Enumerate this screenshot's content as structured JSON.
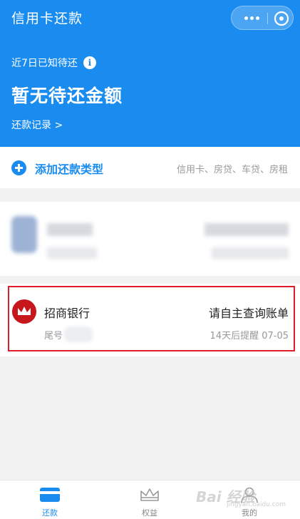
{
  "header": {
    "title": "信用卡还款",
    "pending_label": "近7日已知待还",
    "info_icon": "i",
    "status": "暂无待还金额",
    "history_link": "还款记录 >",
    "bg_color": "#1a8cf0"
  },
  "add_row": {
    "label": "添加还款类型",
    "types": "信用卡、房贷、车贷、房租"
  },
  "bank_card": {
    "name": "招商银行",
    "action": "请自主查询账单",
    "tail_label": "尾号",
    "reminder": "14天后提醒 07-05"
  },
  "tabs": [
    {
      "label": "还款",
      "icon": "card-icon",
      "active": true
    },
    {
      "label": "权益",
      "icon": "crown-icon",
      "active": false
    },
    {
      "label": "我的",
      "icon": "person-icon",
      "active": false
    }
  ],
  "watermark": {
    "text": "Bai 经验",
    "sub": "jingyan.baidu.com"
  }
}
